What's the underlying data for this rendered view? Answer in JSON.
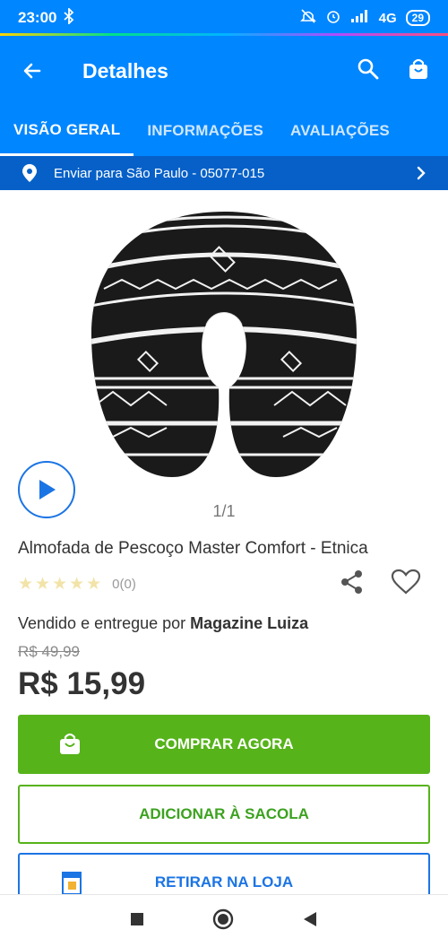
{
  "status": {
    "time": "23:00",
    "network": "4G",
    "battery": "29"
  },
  "appbar": {
    "title": "Detalhes",
    "back_icon": "arrow-left-icon",
    "search_icon": "search-icon",
    "bag_icon": "shopping-bag-icon"
  },
  "tabs": [
    {
      "label": "VISÃO GERAL",
      "active": true
    },
    {
      "label": "INFORMAÇÕES",
      "active": false
    },
    {
      "label": "AVALIAÇÕES",
      "active": false
    }
  ],
  "shipping": {
    "label": "Enviar para São Paulo - 05077-015"
  },
  "gallery": {
    "counter": "1/1"
  },
  "product": {
    "title": "Almofada de Pescoço Master Comfort - Etnica",
    "rating_count": "0(0)",
    "rating_value": 0,
    "seller_prefix": "Vendido e entregue por ",
    "seller_name": "Magazine Luiza",
    "old_price": "R$ 49,99",
    "price": "R$ 15,99"
  },
  "buttons": {
    "buy": "COMPRAR AGORA",
    "add_to_bag": "ADICIONAR À SACOLA",
    "pickup": "RETIRAR NA LOJA"
  },
  "colors": {
    "brand_blue": "#0086ff",
    "ship_bar": "#0660c8",
    "buy_green": "#56b31a",
    "link_blue": "#1b74e4"
  }
}
